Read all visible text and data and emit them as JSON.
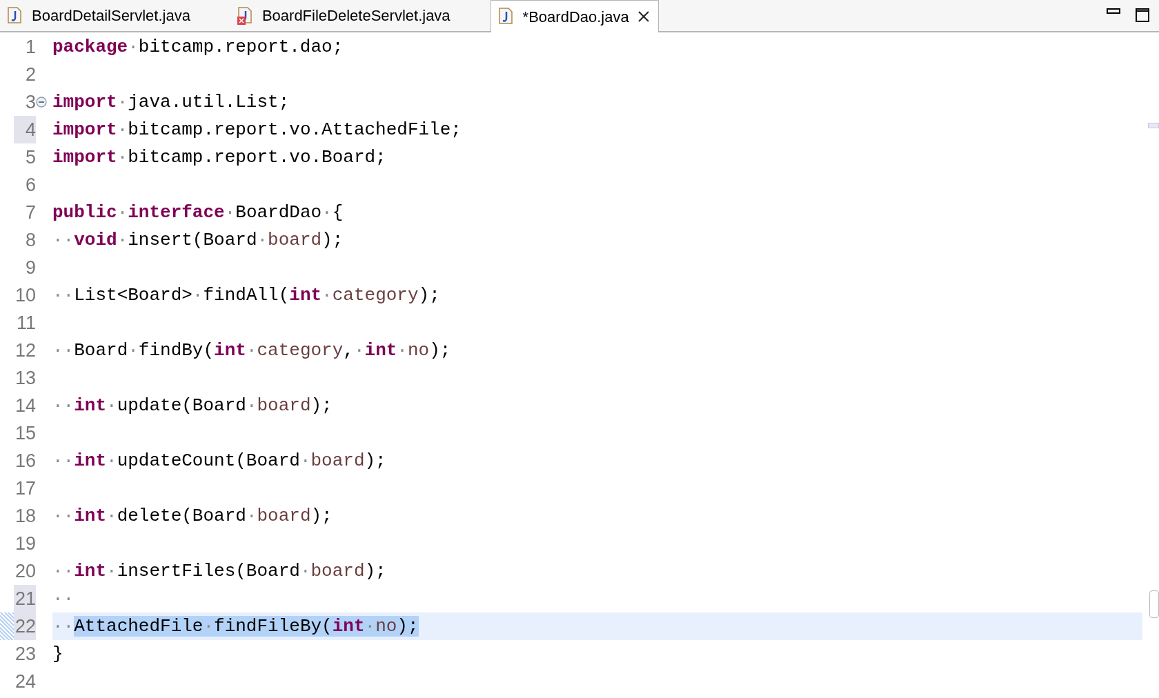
{
  "tabs": [
    {
      "label": "BoardDetailServlet.java",
      "selected": false
    },
    {
      "label": "BoardFileDeleteServlet.java",
      "selected": false,
      "error": true
    },
    {
      "label": "*BoardDao.java",
      "selected": true,
      "closable": true
    }
  ],
  "lines": [
    {
      "number": "1",
      "tokens": [
        {
          "kind": "keyword",
          "text": "package"
        },
        {
          "kind": "plain",
          "text": "·bitcamp.report.dao;"
        }
      ]
    },
    {
      "number": "2"
    },
    {
      "number": "3",
      "fold": true,
      "tokens": [
        {
          "kind": "keyword",
          "text": "import"
        },
        {
          "kind": "plain",
          "text": "·java.util.List;"
        }
      ]
    },
    {
      "number": "4",
      "marked": true,
      "tokens": [
        {
          "kind": "keyword",
          "text": "import"
        },
        {
          "kind": "plain",
          "text": "·bitcamp.report.vo.AttachedFile;"
        }
      ]
    },
    {
      "number": "5",
      "tokens": [
        {
          "kind": "keyword",
          "text": "import"
        },
        {
          "kind": "plain",
          "text": "·bitcamp.report.vo.Board;"
        }
      ]
    },
    {
      "number": "6"
    },
    {
      "number": "7",
      "tokens": [
        {
          "kind": "keyword",
          "text": "public"
        },
        {
          "kind": "plain",
          "text": "·"
        },
        {
          "kind": "keyword",
          "text": "interface"
        },
        {
          "kind": "plain",
          "text": "·BoardDao·{"
        }
      ]
    },
    {
      "number": "8",
      "tokens": [
        {
          "kind": "plain",
          "text": "··"
        },
        {
          "kind": "keyword",
          "text": "void"
        },
        {
          "kind": "plain",
          "text": "·insert(Board·"
        },
        {
          "kind": "param",
          "text": "board"
        },
        {
          "kind": "plain",
          "text": ");"
        }
      ]
    },
    {
      "number": "9"
    },
    {
      "number": "10",
      "tokens": [
        {
          "kind": "plain",
          "text": "··List<Board>·findAll("
        },
        {
          "kind": "keyword",
          "text": "int"
        },
        {
          "kind": "plain",
          "text": "·"
        },
        {
          "kind": "param",
          "text": "category"
        },
        {
          "kind": "plain",
          "text": ");"
        }
      ]
    },
    {
      "number": "11"
    },
    {
      "number": "12",
      "tokens": [
        {
          "kind": "plain",
          "text": "··Board·findBy("
        },
        {
          "kind": "keyword",
          "text": "int"
        },
        {
          "kind": "plain",
          "text": "·"
        },
        {
          "kind": "param",
          "text": "category"
        },
        {
          "kind": "plain",
          "text": ",·"
        },
        {
          "kind": "keyword",
          "text": "int"
        },
        {
          "kind": "plain",
          "text": "·"
        },
        {
          "kind": "param",
          "text": "no"
        },
        {
          "kind": "plain",
          "text": ");"
        }
      ]
    },
    {
      "number": "13"
    },
    {
      "number": "14",
      "tokens": [
        {
          "kind": "plain",
          "text": "··"
        },
        {
          "kind": "keyword",
          "text": "int"
        },
        {
          "kind": "plain",
          "text": "·update(Board·"
        },
        {
          "kind": "param",
          "text": "board"
        },
        {
          "kind": "plain",
          "text": ");"
        }
      ]
    },
    {
      "number": "15"
    },
    {
      "number": "16",
      "tokens": [
        {
          "kind": "plain",
          "text": "··"
        },
        {
          "kind": "keyword",
          "text": "int"
        },
        {
          "kind": "plain",
          "text": "·updateCount(Board·"
        },
        {
          "kind": "param",
          "text": "board"
        },
        {
          "kind": "plain",
          "text": ");"
        }
      ]
    },
    {
      "number": "17"
    },
    {
      "number": "18",
      "tokens": [
        {
          "kind": "plain",
          "text": "··"
        },
        {
          "kind": "keyword",
          "text": "int"
        },
        {
          "kind": "plain",
          "text": "·delete(Board·"
        },
        {
          "kind": "param",
          "text": "board"
        },
        {
          "kind": "plain",
          "text": ");"
        }
      ]
    },
    {
      "number": "19"
    },
    {
      "number": "20",
      "tokens": [
        {
          "kind": "plain",
          "text": "··"
        },
        {
          "kind": "keyword",
          "text": "int"
        },
        {
          "kind": "plain",
          "text": "·insertFiles(Board·"
        },
        {
          "kind": "param",
          "text": "board"
        },
        {
          "kind": "plain",
          "text": ");"
        }
      ]
    },
    {
      "number": "21",
      "marked": true,
      "tokens": [
        {
          "kind": "plain",
          "text": "··"
        }
      ]
    },
    {
      "number": "22",
      "marked": true,
      "current": true,
      "tokens": [
        {
          "kind": "plain",
          "text": "··",
          "selected": false
        },
        {
          "kind": "plain",
          "text": "AttachedFile·findFileBy(",
          "selected": true
        },
        {
          "kind": "keyword",
          "text": "int",
          "selected": true
        },
        {
          "kind": "plain",
          "text": "·",
          "selected": true
        },
        {
          "kind": "param",
          "text": "no",
          "selected": true
        },
        {
          "kind": "plain",
          "text": ");",
          "selected": true
        }
      ]
    },
    {
      "number": "23",
      "tokens": [
        {
          "kind": "plain",
          "text": "}"
        }
      ]
    },
    {
      "number": "24"
    }
  ]
}
